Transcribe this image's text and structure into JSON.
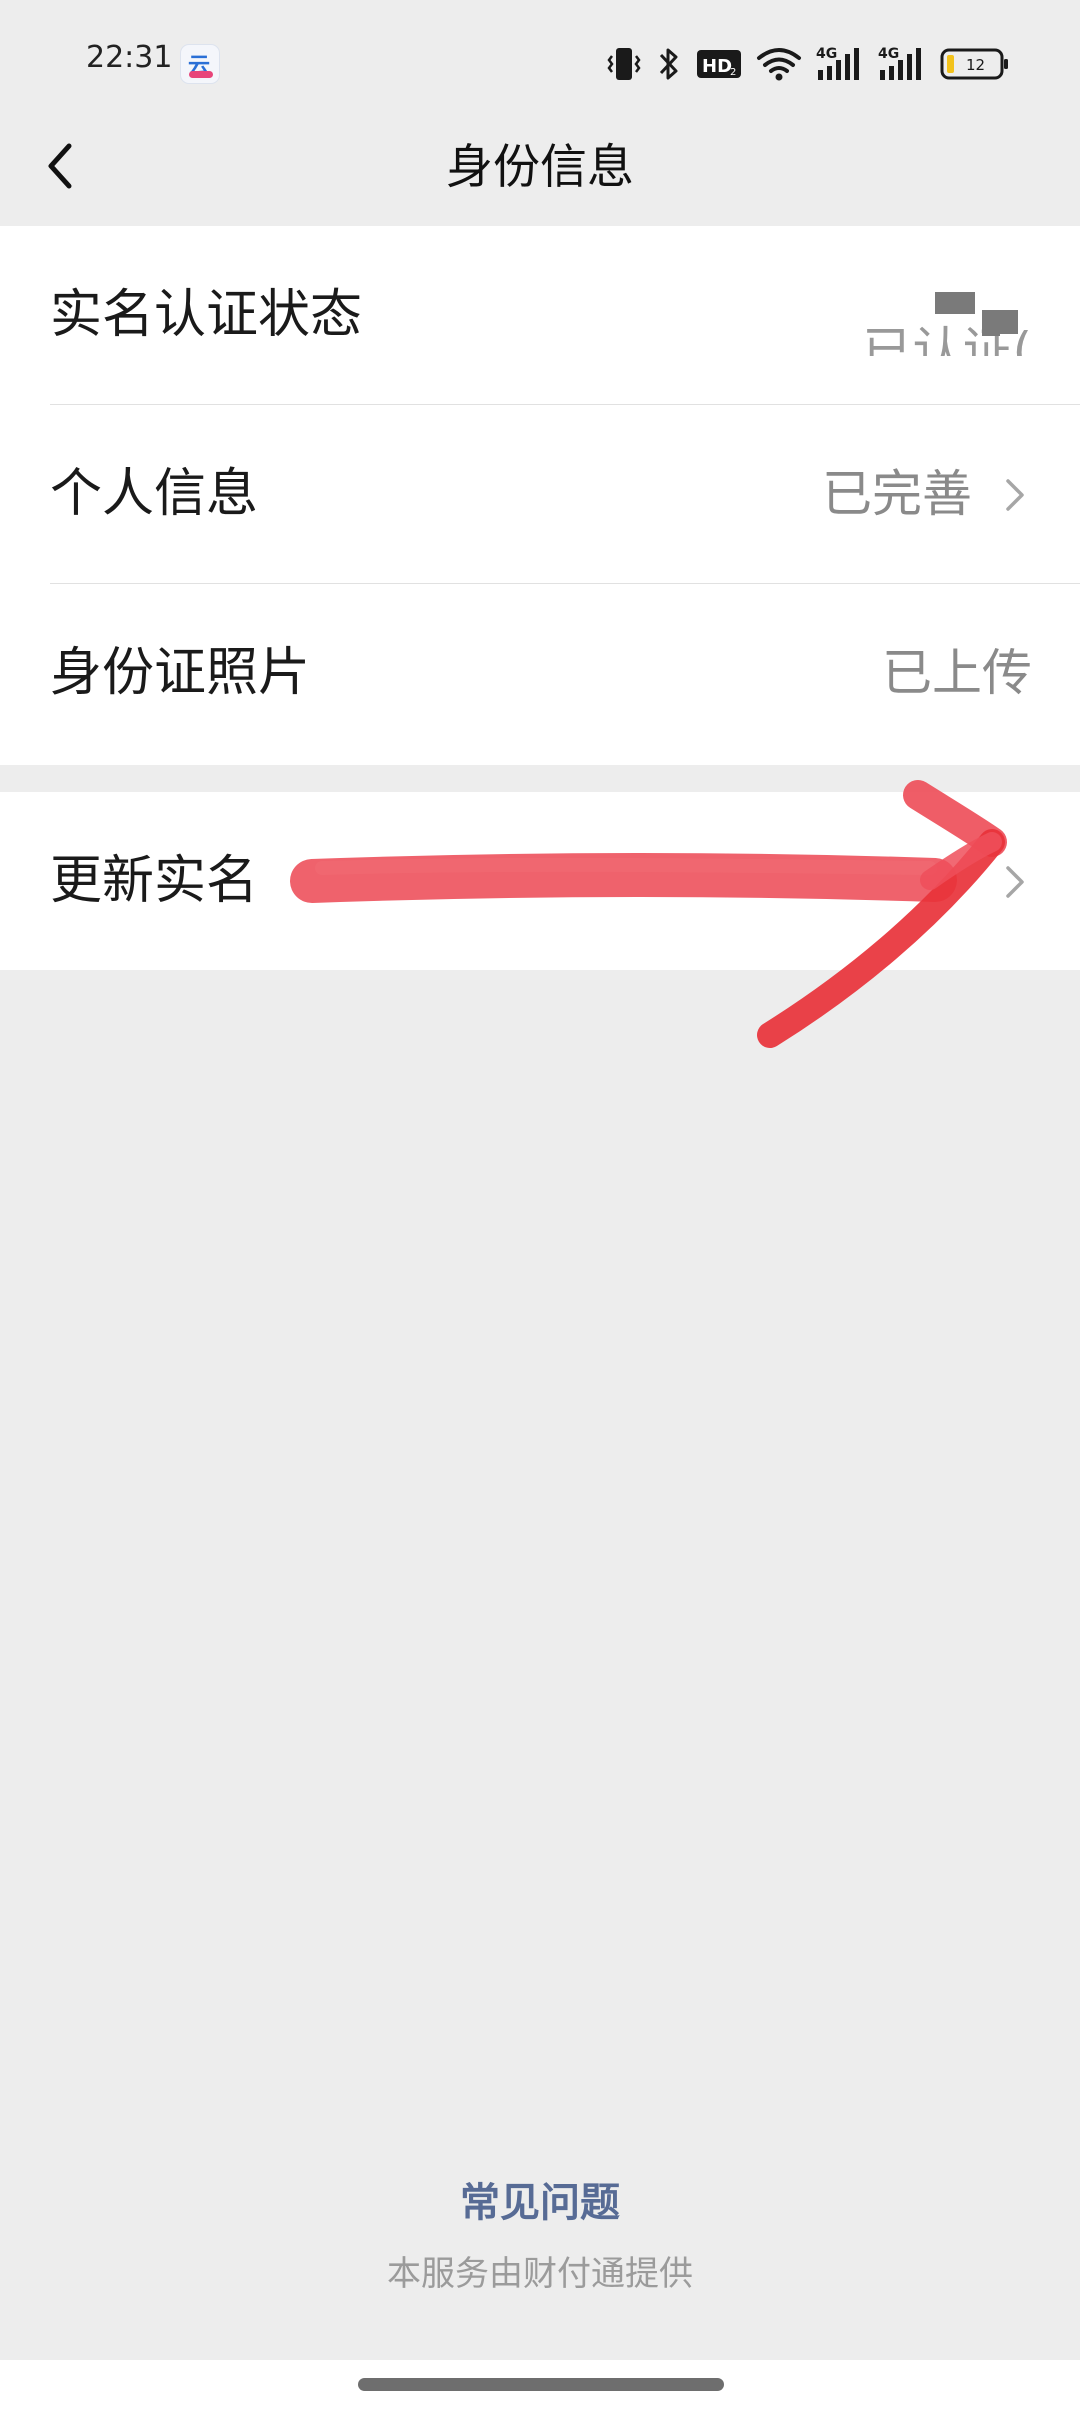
{
  "status_bar": {
    "time": "22:31",
    "app_badge": "云",
    "battery_level": "12",
    "network_labels": [
      "HD",
      "4G",
      "4G"
    ],
    "icons": [
      "app-notification-icon",
      "vibrate-icon",
      "bluetooth-icon",
      "hd-icon",
      "wifi-icon",
      "signal-4g-icon",
      "signal-4g-icon",
      "battery-icon"
    ]
  },
  "nav": {
    "title": "身份信息",
    "back_icon": "chevron-left-icon"
  },
  "rows": [
    {
      "label": "实名认证状态",
      "value": "已认证(",
      "redacted": true,
      "chevron": false
    },
    {
      "label": "个人信息",
      "value": "已完善",
      "chevron": true
    },
    {
      "label": "身份证照片",
      "value": "已上传",
      "chevron": false
    },
    {
      "label": "更新实名",
      "value": "",
      "chevron": true
    }
  ],
  "footer": {
    "faq": "常见问题",
    "note": "本服务由财付通提供"
  },
  "colors": {
    "background": "#ededed",
    "card": "#ffffff",
    "link": "#576b95",
    "annotation_red": "#e8323a"
  },
  "annotation": "red-arrow-pointing-to-update-name"
}
